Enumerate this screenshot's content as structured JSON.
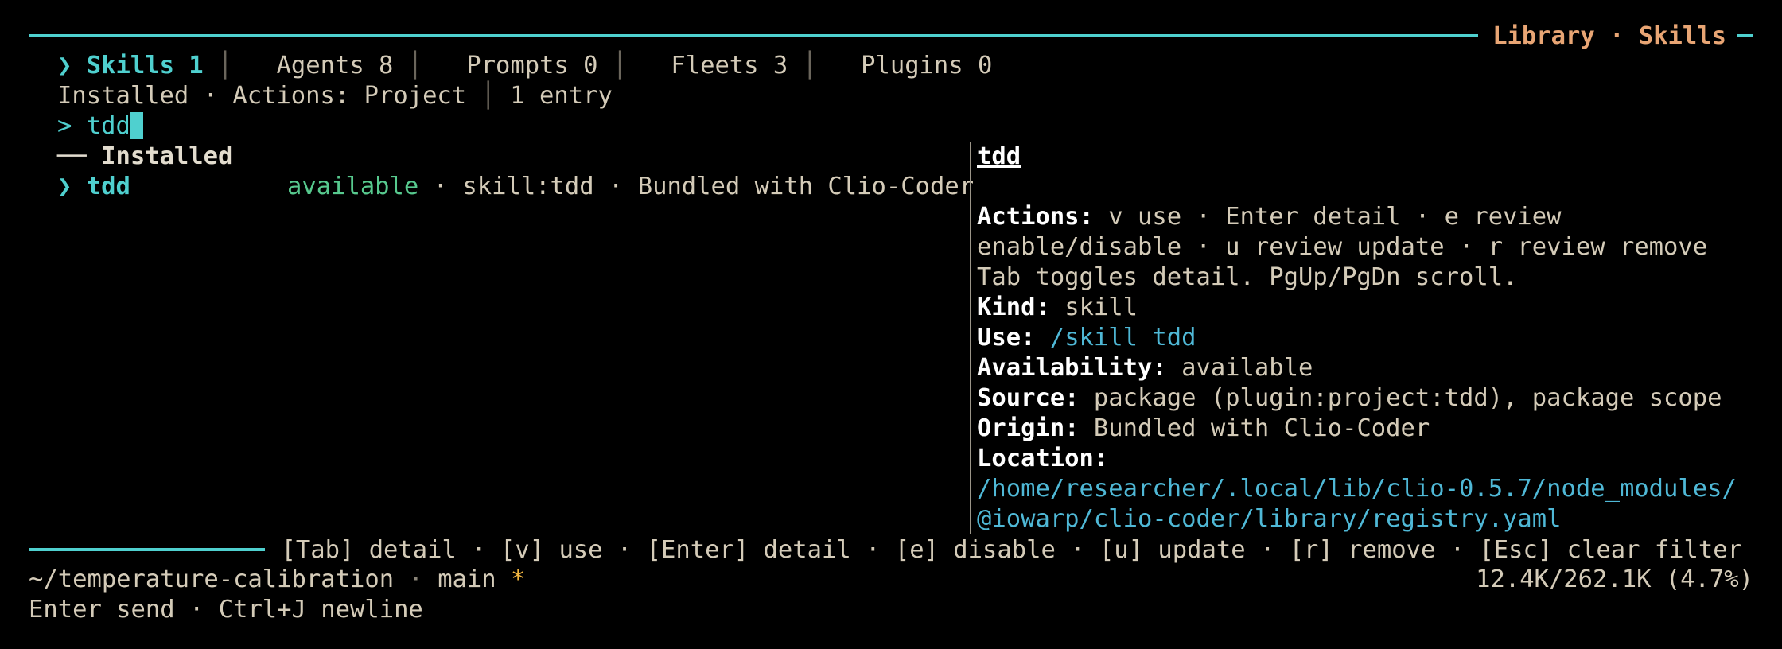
{
  "header": {
    "title": "Library · Skills"
  },
  "tabs": [
    {
      "label": "Skills 1",
      "active": true,
      "marker": "❯"
    },
    {
      "label": "Agents 8",
      "active": false
    },
    {
      "label": "Prompts 0",
      "active": false
    },
    {
      "label": "Fleets 3",
      "active": false
    },
    {
      "label": "Plugins 0",
      "active": false
    }
  ],
  "tab_separator": "│",
  "subheader": {
    "filter": "Installed · Actions: Project",
    "count": "1 entry"
  },
  "search": {
    "prompt": ">",
    "query": "tdd"
  },
  "list": {
    "section_prefix": "──",
    "section_label": "Installed",
    "items": [
      {
        "marker": "❯",
        "name": "tdd",
        "status": "available",
        "meta": "· skill:tdd · Bundled with Clio-Coder"
      }
    ]
  },
  "detail": {
    "title": "tdd",
    "actions_label": "Actions:",
    "actions_line1": "v use · Enter detail · e review",
    "actions_line2": "enable/disable · u review update · r review remove",
    "hint": "Tab toggles detail. PgUp/PgDn scroll.",
    "kind_label": "Kind:",
    "kind": "skill",
    "use_label": "Use:",
    "use": "/skill tdd",
    "availability_label": "Availability:",
    "availability": "available",
    "source_label": "Source:",
    "source": "package (plugin:project:tdd), package scope",
    "origin_label": "Origin:",
    "origin": "Bundled with Clio-Coder",
    "location_label": "Location:",
    "location_line1": "/home/researcher/.local/lib/clio-0.5.7/node_modules/",
    "location_line2": "@iowarp/clio-coder/library/registry.yaml"
  },
  "footer": {
    "keybinds": [
      {
        "key": "[Tab]",
        "action": "detail"
      },
      {
        "key": "[v]",
        "action": "use"
      },
      {
        "key": "[Enter]",
        "action": "detail"
      },
      {
        "key": "[e]",
        "action": "disable"
      },
      {
        "key": "[u]",
        "action": "update"
      },
      {
        "key": "[r]",
        "action": "remove"
      },
      {
        "key": "[Esc]",
        "action": "clear filter"
      }
    ]
  },
  "statusbar": {
    "path": "~/temperature-calibration",
    "dot": "·",
    "branch": "main",
    "dirty": "*",
    "tokens": "12.4K/262.1K (4.7%)",
    "hint": "Enter send · Ctrl+J newline"
  },
  "colors": {
    "accent": "#4fd0cf",
    "title": "#e8a574",
    "available": "#57c98e",
    "link": "#4fb8d6",
    "dirty": "#f2b640"
  }
}
